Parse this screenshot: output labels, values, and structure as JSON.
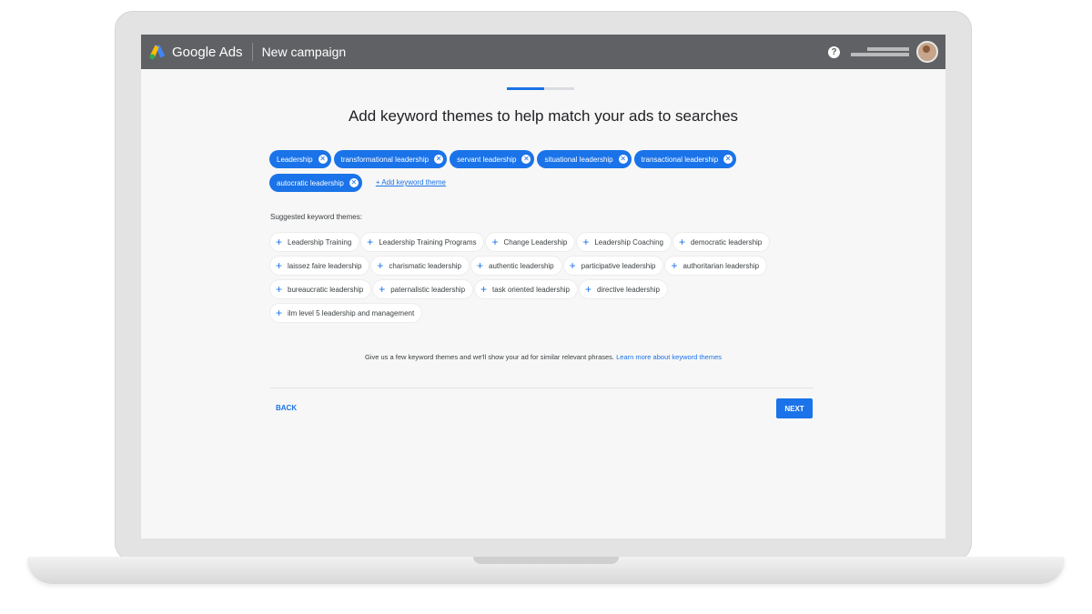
{
  "header": {
    "brand": "Google Ads",
    "campaign_title": "New campaign",
    "help_glyph": "?"
  },
  "progress": {
    "fraction": 0.55
  },
  "headline": "Add keyword themes to help match your ads to searches",
  "selected_themes": [
    "Leadership",
    "transformational leadership",
    "servant leadership",
    "situational leadership",
    "transactional leadership",
    "autocratic leadership"
  ],
  "add_theme_label": "+ Add keyword theme",
  "suggested_label": "Suggested keyword themes:",
  "suggested_themes": [
    "Leadership Training",
    "Leadership Training Programs",
    "Change Leadership",
    "Leadership Coaching",
    "democratic leadership",
    "laissez faire leadership",
    "charismatic leadership",
    "authentic leadership",
    "participative leadership",
    "authoritarian leadership",
    "bureaucratic leadership",
    "paternalistic leadership",
    "task oriented leadership",
    "directive leadership",
    "ilm level 5 leadership and management"
  ],
  "info": {
    "text": "Give us a few keyword themes and we'll show your ad for similar relevant phrases.",
    "link": "Learn more about keyword themes"
  },
  "buttons": {
    "back": "BACK",
    "next": "NEXT"
  },
  "colors": {
    "accent": "#1a73e8",
    "topbar": "#5f6164"
  },
  "icons": {
    "remove": "close-circle-icon",
    "add": "plus-icon",
    "help": "help-circle-icon"
  }
}
